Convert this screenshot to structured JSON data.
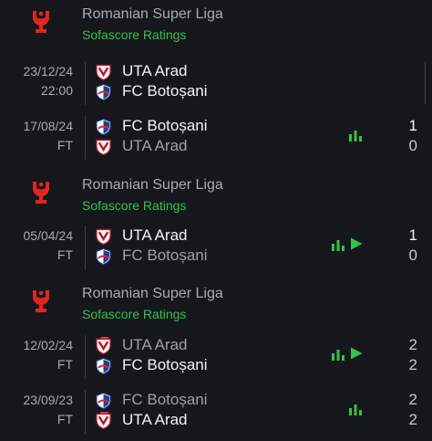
{
  "colors": {
    "background": "#15171c",
    "accent_green": "#33c24b",
    "red_card": "#e3384b",
    "league_red": "#e0261f"
  },
  "groups": [
    {
      "league": {
        "name": "Romanian Super Liga",
        "subtitle": "Sofascore Ratings",
        "icon": "superliga-logo-icon"
      },
      "matches": [
        {
          "date": "23/12/24",
          "status": "22:00",
          "home": {
            "name": "UTA Arad",
            "crest": "uta-arad-crest-icon",
            "result": "win",
            "red_card": false
          },
          "away": {
            "name": "FC Botoșani",
            "crest": "fc-botosani-crest-icon",
            "result": "win",
            "red_card": false
          },
          "score_home": "",
          "score_away": "",
          "has_stats": false,
          "has_highlights": false,
          "upcoming": true
        },
        {
          "date": "17/08/24",
          "status": "FT",
          "home": {
            "name": "FC Botoșani",
            "crest": "fc-botosani-crest-icon",
            "result": "win",
            "red_card": false
          },
          "away": {
            "name": "UTA Arad",
            "crest": "uta-arad-crest-icon",
            "result": "lose",
            "red_card": false
          },
          "score_home": "1",
          "score_away": "0",
          "has_stats": true,
          "has_highlights": false,
          "upcoming": false
        }
      ]
    },
    {
      "league": {
        "name": "Romanian Super Liga",
        "subtitle": "Sofascore Ratings",
        "icon": "superliga-logo-icon"
      },
      "matches": [
        {
          "date": "05/04/24",
          "status": "FT",
          "home": {
            "name": "UTA Arad",
            "crest": "uta-arad-crest-icon",
            "result": "win",
            "red_card": false
          },
          "away": {
            "name": "FC Botoșani",
            "crest": "fc-botosani-crest-icon",
            "result": "lose",
            "red_card": false
          },
          "score_home": "1",
          "score_away": "0",
          "has_stats": true,
          "has_highlights": true,
          "upcoming": false
        }
      ]
    },
    {
      "league": {
        "name": "Romanian Super Liga",
        "subtitle": "Sofascore Ratings",
        "icon": "superliga-logo-icon"
      },
      "matches": [
        {
          "date": "12/02/24",
          "status": "FT",
          "home": {
            "name": "UTA Arad",
            "crest": "uta-arad-crest-icon",
            "result": "draw",
            "red_card": true
          },
          "away": {
            "name": "FC Botoșani",
            "crest": "fc-botosani-crest-icon",
            "result": "draw",
            "red_card": false
          },
          "score_home": "2",
          "score_away": "2",
          "has_stats": true,
          "has_highlights": true,
          "upcoming": false
        },
        {
          "date": "23/09/23",
          "status": "FT",
          "home": {
            "name": "FC Botoșani",
            "crest": "fc-botosani-crest-icon",
            "result": "draw",
            "red_card": false
          },
          "away": {
            "name": "UTA Arad",
            "crest": "uta-arad-crest-icon",
            "result": "draw",
            "red_card": true
          },
          "score_home": "2",
          "score_away": "2",
          "has_stats": true,
          "has_highlights": false,
          "upcoming": false
        }
      ]
    }
  ]
}
